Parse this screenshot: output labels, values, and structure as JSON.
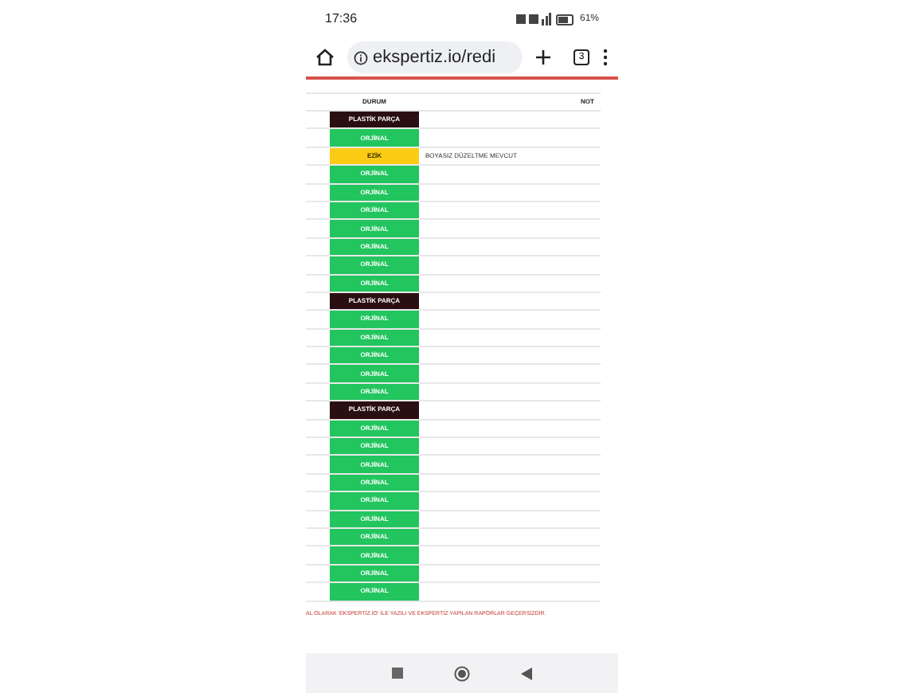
{
  "status_bar": {
    "time": "17:36",
    "battery": "61%"
  },
  "browser": {
    "url": "ekspertiz.io/redi",
    "tab_count": "3"
  },
  "table": {
    "columns": [
      "DURUM",
      "NOT"
    ],
    "rows": [
      {
        "kind": "plastic",
        "status": "PLASTİK PARÇA"
      },
      {
        "kind": "original",
        "status": "ORJİNAL"
      },
      {
        "kind": "dent",
        "status": "EZİK",
        "note": "BOYASIZ DÜZELTME MEVCUT"
      },
      {
        "kind": "original",
        "status": "ORJİNAL"
      },
      {
        "kind": "original",
        "status": "ORJİNAL"
      },
      {
        "kind": "original",
        "status": "ORJİNAL"
      },
      {
        "kind": "original",
        "status": "ORJİNAL"
      },
      {
        "kind": "original",
        "status": "ORJİNAL"
      },
      {
        "kind": "original",
        "status": "ORJİNAL"
      },
      {
        "kind": "original",
        "status": "ORJİNAL"
      },
      {
        "kind": "plastic",
        "status": "PLASTİK PARÇA"
      },
      {
        "kind": "original",
        "status": "ORJİNAL"
      },
      {
        "kind": "original",
        "status": "ORJİNAL"
      },
      {
        "kind": "original",
        "status": "ORJİNAL"
      },
      {
        "kind": "original",
        "status": "ORJİNAL"
      },
      {
        "kind": "original",
        "status": "ORJİNAL"
      },
      {
        "kind": "plastic",
        "status": "PLASTİK PARÇA"
      },
      {
        "kind": "original",
        "status": "ORJİNAL"
      },
      {
        "kind": "original",
        "status": "ORJİNAL"
      },
      {
        "kind": "original",
        "status": "ORJİNAL"
      },
      {
        "kind": "original",
        "status": "ORJİNAL"
      },
      {
        "kind": "original",
        "status": "ORJİNAL"
      },
      {
        "kind": "original",
        "status": "ORJİNAL"
      },
      {
        "kind": "original",
        "status": "ORJİNAL"
      },
      {
        "kind": "original",
        "status": "ORJİNAL"
      },
      {
        "kind": "original",
        "status": "ORJİNAL"
      },
      {
        "kind": "original",
        "status": "ORJİNAL"
      }
    ]
  },
  "footer_note": "AL OLARAK 'EKSPERTİZ.İO' İLE YAZILI VE EKSPERTİZ YAPILAN RAPORLAR GEÇERSİZDİR."
}
